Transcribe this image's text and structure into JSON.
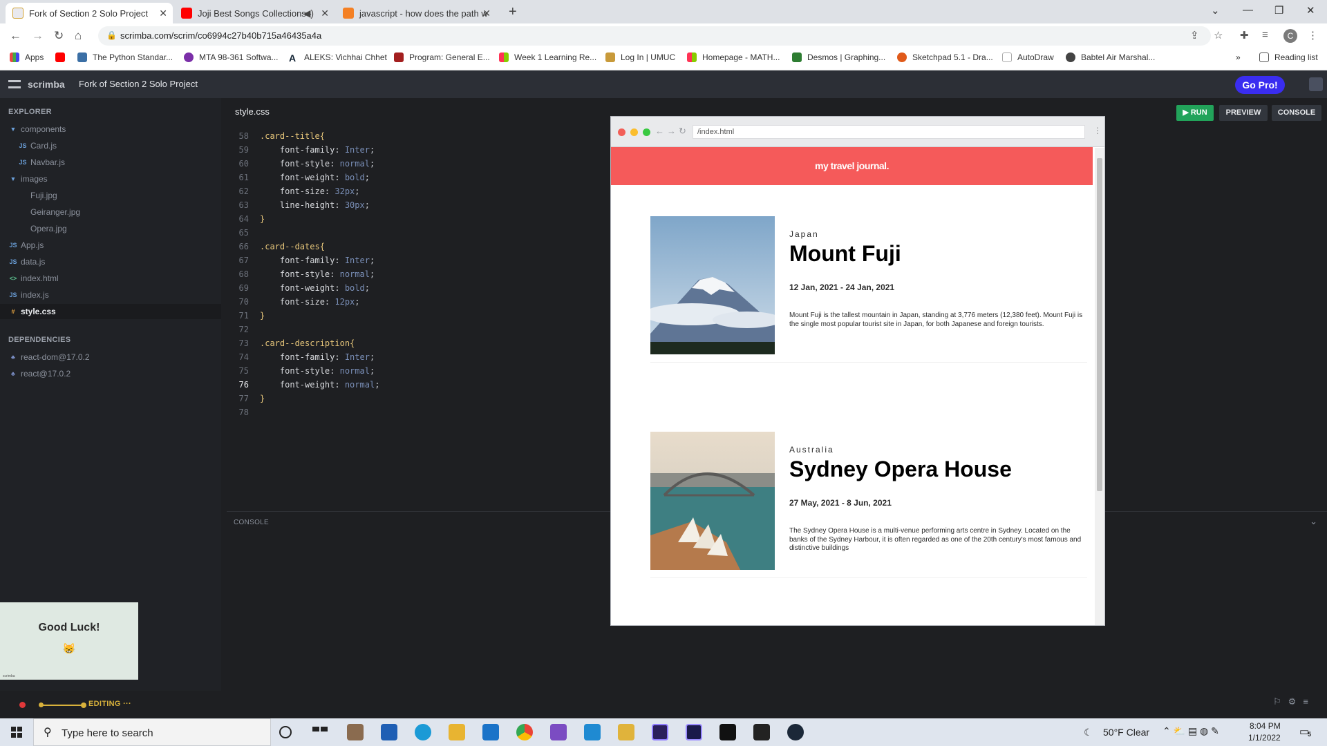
{
  "browser": {
    "tabs": [
      {
        "title": "Fork of Section 2 Solo Project",
        "active": true
      },
      {
        "title": "Joji Best Songs Collections -",
        "active": false
      },
      {
        "title": "javascript - how does the path w",
        "active": false
      }
    ],
    "url": "scrimba.com/scrim/co6994c27b40b715a46435a4a",
    "profile_initial": "C",
    "bookmarks": [
      "Apps",
      "The Python Standar...",
      "MTA 98-361 Softwa...",
      "ALEKS: Vichhai Chhet",
      "Program: General E...",
      "Week 1 Learning Re...",
      "Log In | UMUC",
      "Homepage - MATH...",
      "Desmos | Graphing...",
      "Sketchpad 5.1 - Dra...",
      "AutoDraw",
      "Babtel Air Marshal..."
    ],
    "more_bookmarks": "»",
    "reading_list": "Reading list"
  },
  "scrimba": {
    "logo_text": "scrimba",
    "project_title": "Fork of Section 2 Solo Project",
    "go_pro": "Go Pro!"
  },
  "sidebar": {
    "explorer_heading": "EXPLORER",
    "tree": [
      {
        "label": "components",
        "type": "folder"
      },
      {
        "label": "Card.js",
        "type": "js"
      },
      {
        "label": "Navbar.js",
        "type": "js"
      },
      {
        "label": "images",
        "type": "folder"
      },
      {
        "label": "Fuji.jpg",
        "type": "img"
      },
      {
        "label": "Geiranger.jpg",
        "type": "img"
      },
      {
        "label": "Opera.jpg",
        "type": "img"
      },
      {
        "label": "App.js",
        "type": "js"
      },
      {
        "label": "data.js",
        "type": "js"
      },
      {
        "label": "index.html",
        "type": "html"
      },
      {
        "label": "index.js",
        "type": "js"
      },
      {
        "label": "style.css",
        "type": "css",
        "selected": true
      }
    ],
    "icons": {
      "js": "JS",
      "html": "<>",
      "css": "#",
      "folder": "▼"
    },
    "dependencies_heading": "DEPENDENCIES",
    "dependencies": [
      "react-dom@17.0.2",
      "react@17.0.2"
    ],
    "good_luck": "Good Luck!",
    "good_luck_emoji": "😸",
    "watermark": "scrimba",
    "status": "EDITING",
    "status_more": "···"
  },
  "editor": {
    "filename": "style.css",
    "lines": [
      {
        "n": "58",
        "sel": ".card--title{"
      },
      {
        "n": "59",
        "prop": "    font-family: ",
        "val": "Inter",
        "end": ";"
      },
      {
        "n": "60",
        "prop": "    font-style: ",
        "val": "normal",
        "end": ";"
      },
      {
        "n": "61",
        "prop": "    font-weight: ",
        "val": "bold",
        "end": ";"
      },
      {
        "n": "62",
        "prop": "    font-size: ",
        "val": "32px",
        "end": ";"
      },
      {
        "n": "63",
        "prop": "    line-height: ",
        "val": "30px",
        "end": ";"
      },
      {
        "n": "64",
        "sel": "}"
      },
      {
        "n": "65"
      },
      {
        "n": "66",
        "sel": ".card--dates{"
      },
      {
        "n": "67",
        "prop": "    font-family: ",
        "val": "Inter",
        "end": ";"
      },
      {
        "n": "68",
        "prop": "    font-style: ",
        "val": "normal",
        "end": ";"
      },
      {
        "n": "69",
        "prop": "    font-weight: ",
        "val": "bold",
        "end": ";"
      },
      {
        "n": "70",
        "prop": "    font-size: ",
        "val": "12px",
        "end": ";"
      },
      {
        "n": "71",
        "sel": "}"
      },
      {
        "n": "72"
      },
      {
        "n": "73",
        "sel": ".card--description{"
      },
      {
        "n": "74",
        "prop": "    font-family: ",
        "val": "Inter",
        "end": ";"
      },
      {
        "n": "75",
        "prop": "    font-style: ",
        "val": "normal",
        "end": ";"
      },
      {
        "n": "76",
        "prop": "    font-weight: ",
        "val": "normal",
        "end": ";",
        "current": true
      },
      {
        "n": "77",
        "sel": "}"
      },
      {
        "n": "78"
      }
    ],
    "run": "RUN",
    "preview": "PREVIEW",
    "console": "CONSOLE",
    "console_pane_label": "CONSOLE"
  },
  "preview": {
    "url": "/index.html",
    "navbar_title": "my travel journal.",
    "cards": [
      {
        "location": "Japan",
        "title": "Mount Fuji",
        "dates": "12 Jan, 2021 - 24 Jan, 2021",
        "description": "Mount Fuji is the tallest mountain in Japan, standing at 3,776 meters (12,380 feet). Mount Fuji is the single most popular tourist site in Japan, for both Japanese and foreign tourists."
      },
      {
        "location": "Australia",
        "title": "Sydney Opera House",
        "dates": "27 May, 2021 - 8 Jun, 2021",
        "description": "The Sydney Opera House is a multi-venue performing arts centre in Sydney. Located on the banks of the Sydney Harbour, it is often regarded as one of the 20th century's most famous and distinctive buildings"
      }
    ]
  },
  "taskbar": {
    "search_placeholder": "Type here to search",
    "weather": "50°F  Clear",
    "time": "8:04 PM",
    "date": "1/1/2022",
    "notifications": "5"
  }
}
